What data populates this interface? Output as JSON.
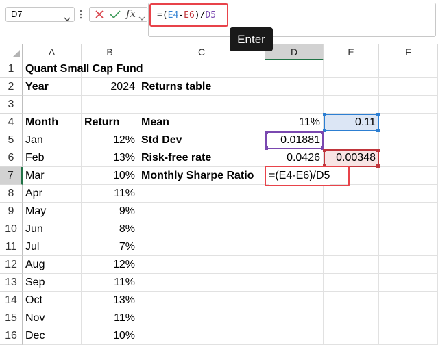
{
  "toolbar": {
    "name_box": "D7",
    "formula_input": "=(E4-E6)/D5",
    "formula_parts": [
      {
        "text": "=(",
        "color": "#000000"
      },
      {
        "text": "E4",
        "color": "#2d7fd2"
      },
      {
        "text": "-",
        "color": "#000000"
      },
      {
        "text": "E6",
        "color": "#c0353b"
      },
      {
        "text": ")/",
        "color": "#000000"
      },
      {
        "text": "D5",
        "color": "#7a48b0"
      }
    ],
    "cancel_icon": "cancel-x-icon",
    "enter_icon": "checkmark-icon",
    "function_icon": "fx",
    "tooltip": "Enter"
  },
  "columns": [
    "A",
    "B",
    "C",
    "D",
    "E",
    "F"
  ],
  "rows": [
    "1",
    "2",
    "3",
    "4",
    "5",
    "6",
    "7",
    "8",
    "9",
    "10",
    "11",
    "12",
    "13",
    "14",
    "15",
    "16"
  ],
  "cells": {
    "A1": "Quant Small Cap Fund",
    "A2": "Year",
    "B2": "2024",
    "C2": "Returns table",
    "A4": "Month",
    "B4": "Return",
    "C4": "Mean",
    "D4": "11%",
    "E4": "0.11",
    "A5": "Jan",
    "B5": "12%",
    "C5": "Std Dev",
    "D5": "0.01881",
    "A6": "Feb",
    "B6": "13%",
    "C6": "Risk-free rate",
    "D6": "0.0426",
    "E6": "0.00348",
    "A7": "Mar",
    "B7": "10%",
    "C7": "Monthly Sharpe Ratio",
    "A8": "Apr",
    "B8": "11%",
    "A9": "May",
    "B9": "9%",
    "A10": "Jun",
    "B10": "8%",
    "A11": "Jul",
    "B11": "7%",
    "A12": "Aug",
    "B12": "12%",
    "A13": "Sep",
    "B13": "11%",
    "A14": "Oct",
    "B14": "13%",
    "A15": "Nov",
    "B15": "11%",
    "A16": "Dec",
    "B16": "10%"
  },
  "editing_cell": {
    "ref": "D7",
    "parts": [
      {
        "text": "=(",
        "color": "#000000"
      },
      {
        "text": "E4",
        "color": "#000000"
      },
      {
        "text": "-",
        "color": "#000000"
      },
      {
        "text": "E6",
        "color": "#000000"
      },
      {
        "text": ")/",
        "color": "#000000"
      },
      {
        "text": "D5",
        "color": "#000000"
      }
    ]
  },
  "colors": {
    "accent_green": "#217346",
    "highlight_red": "#e8434a",
    "ref_blue": "#2d7fd2",
    "ref_purple": "#7a48b0",
    "ref_red": "#c0353b"
  }
}
